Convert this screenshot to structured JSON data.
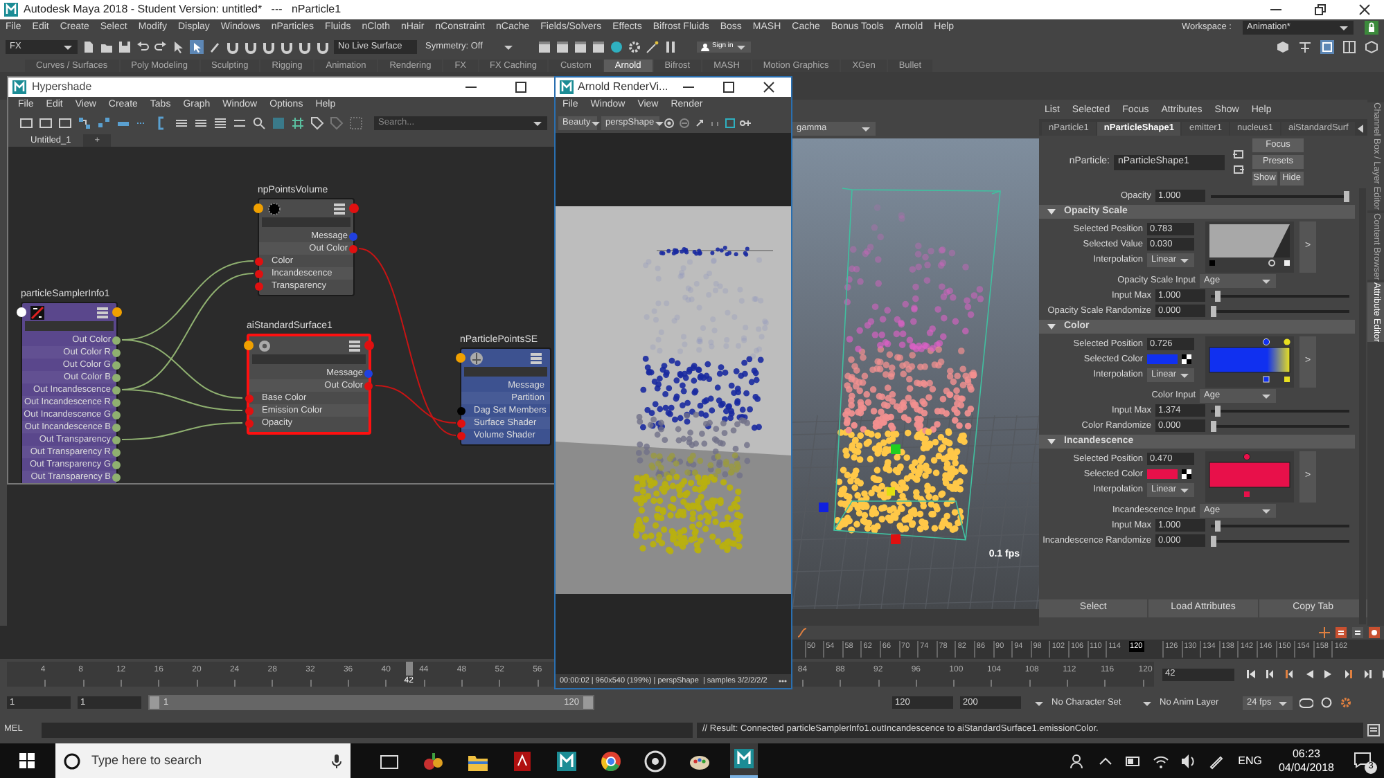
{
  "window": {
    "title": "Autodesk Maya 2018 - Student Version: untitled*   ---   nParticle1"
  },
  "menu_bar": [
    "File",
    "Edit",
    "Create",
    "Select",
    "Modify",
    "Display",
    "Windows",
    "nParticles",
    "Fluids",
    "nCloth",
    "nHair",
    "nConstraint",
    "nCache",
    "Fields/Solvers",
    "Effects",
    "Bifrost Fluids",
    "Boss",
    "MASH",
    "Cache",
    "Bonus Tools",
    "Arnold",
    "Help"
  ],
  "workspace": {
    "label": "Workspace :",
    "value": "Animation*"
  },
  "status_line": {
    "menu_set": "FX",
    "live_surface": "No Live Surface",
    "symmetry": "Symmetry: Off",
    "sign_in": "Sign in"
  },
  "shelf_tabs": [
    {
      "label": "Curves / Surfaces",
      "selected": false
    },
    {
      "label": "Poly Modeling",
      "selected": false
    },
    {
      "label": "Sculpting",
      "selected": false
    },
    {
      "label": "Rigging",
      "selected": false
    },
    {
      "label": "Animation",
      "selected": false
    },
    {
      "label": "Rendering",
      "selected": false
    },
    {
      "label": "FX",
      "selected": false
    },
    {
      "label": "FX Caching",
      "selected": false
    },
    {
      "label": "Custom",
      "selected": false
    },
    {
      "label": "Arnold",
      "selected": true
    },
    {
      "label": "Bifrost",
      "selected": false
    },
    {
      "label": "MASH",
      "selected": false
    },
    {
      "label": "Motion Graphics",
      "selected": false
    },
    {
      "label": "XGen",
      "selected": false
    },
    {
      "label": "Bullet",
      "selected": false
    }
  ],
  "hypershade": {
    "title": "Hypershade",
    "menu": [
      "File",
      "Edit",
      "View",
      "Create",
      "Tabs",
      "Graph",
      "Window",
      "Options",
      "Help"
    ],
    "search": {
      "placeholder": "Search..."
    },
    "tabs": [
      {
        "label": "Untitled_1",
        "selected": true
      },
      {
        "label": "+",
        "selected": false
      }
    ],
    "nodes": [
      {
        "name": "npPointsVolume",
        "kind": "volume_shader",
        "selected": false,
        "ports": [
          {
            "label": "Message",
            "kind": "out",
            "color": "#2040e0"
          },
          {
            "label": "Out Color",
            "kind": "out",
            "color": "#e01010"
          },
          {
            "label": "Color",
            "kind": "in",
            "color": "#e01010"
          },
          {
            "label": "Incandescence",
            "kind": "in",
            "color": "#e01010"
          },
          {
            "label": "Transparency",
            "kind": "in",
            "color": "#e01010"
          }
        ]
      },
      {
        "name": "particleSamplerInfo1",
        "kind": "utility",
        "selected": false,
        "ports": [
          {
            "label": "Out Color",
            "kind": "out",
            "color": "#8fb070"
          },
          {
            "label": "Out Color R",
            "kind": "out",
            "color": "#8fb070"
          },
          {
            "label": "Out Color G",
            "kind": "out",
            "color": "#8fb070"
          },
          {
            "label": "Out Color B",
            "kind": "out",
            "color": "#8fb070"
          },
          {
            "label": "Out Incandescence",
            "kind": "out",
            "color": "#8fb070"
          },
          {
            "label": "Out Incandescence R",
            "kind": "out",
            "color": "#8fb070"
          },
          {
            "label": "Out Incandescence G",
            "kind": "out",
            "color": "#8fb070"
          },
          {
            "label": "Out Incandescence B",
            "kind": "out",
            "color": "#8fb070"
          },
          {
            "label": "Out Transparency",
            "kind": "out",
            "color": "#8fb070"
          },
          {
            "label": "Out Transparency R",
            "kind": "out",
            "color": "#8fb070"
          },
          {
            "label": "Out Transparency G",
            "kind": "out",
            "color": "#8fb070"
          },
          {
            "label": "Out Transparency B",
            "kind": "out",
            "color": "#8fb070"
          }
        ]
      },
      {
        "name": "aiStandardSurface1",
        "kind": "surface_shader",
        "selected": true,
        "ports": [
          {
            "label": "Message",
            "kind": "out",
            "color": "#2040e0"
          },
          {
            "label": "Out Color",
            "kind": "out",
            "color": "#e01010"
          },
          {
            "label": "Base Color",
            "kind": "in",
            "color": "#e01010"
          },
          {
            "label": "Emission Color",
            "kind": "in",
            "color": "#e01010"
          },
          {
            "label": "Opacity",
            "kind": "in",
            "color": "#e01010"
          }
        ]
      },
      {
        "name": "nParticlePointsSE",
        "kind": "shading_group",
        "selected": false,
        "ports": [
          {
            "label": "Message",
            "kind": "out"
          },
          {
            "label": "Partition",
            "kind": "out"
          },
          {
            "label": "Dag Set Members",
            "kind": "in",
            "color": "#000000"
          },
          {
            "label": "Surface Shader",
            "kind": "in",
            "color": "#e01010"
          },
          {
            "label": "Volume Shader",
            "kind": "in",
            "color": "#e01010"
          }
        ]
      }
    ]
  },
  "render_view": {
    "title": "Arnold RenderVi...",
    "menu": [
      "File",
      "Window",
      "View",
      "Render"
    ],
    "aov": "Beauty",
    "camera": "perspShape",
    "status": "00:00:02 | 960x540 (199%) | perspShape  | samples 3/2/2/2/2"
  },
  "viewport": {
    "color_management": "gamma",
    "fps": "0.1 fps"
  },
  "attribute_editor": {
    "menu": [
      "List",
      "Selected",
      "Focus",
      "Attributes",
      "Show",
      "Help"
    ],
    "tabs": [
      {
        "label": "nParticle1",
        "selected": false
      },
      {
        "label": "nParticleShape1",
        "selected": true
      },
      {
        "label": "emitter1",
        "selected": false
      },
      {
        "label": "nucleus1",
        "selected": false
      },
      {
        "label": "aiStandardSurf",
        "selected": false
      }
    ],
    "node": {
      "label": "nParticle:",
      "value": "nParticleShape1"
    },
    "buttons": [
      "Focus",
      "Presets",
      "Show",
      "Hide"
    ],
    "opacity": {
      "label": "Opacity",
      "value": "1.000",
      "level": 1
    },
    "sections": [
      {
        "title": "Opacity Scale",
        "expanded": true,
        "kind": "curve",
        "ramp_button": ">",
        "fields": [
          {
            "label": "Selected Position",
            "value": "0.783",
            "kind": "number"
          },
          {
            "label": "Selected Value",
            "value": "0.030",
            "kind": "number"
          },
          {
            "label": "Interpolation",
            "value": "Linear",
            "kind": "dropdown"
          }
        ],
        "rows": [
          {
            "label": "Opacity Scale Input",
            "value": "Age",
            "kind": "dropdown"
          },
          {
            "label": "Input Max",
            "value": "1.000",
            "kind": "slider",
            "level": 0.03
          },
          {
            "label": "Opacity Scale Randomize",
            "value": "0.000",
            "kind": "slider",
            "level": 0
          }
        ]
      },
      {
        "title": "Color",
        "expanded": true,
        "kind": "gradient",
        "ramp_button": ">",
        "fields": [
          {
            "label": "Selected Position",
            "value": "0.726",
            "kind": "number"
          },
          {
            "label": "Selected Color",
            "kind": "color",
            "color": "#1030f0"
          },
          {
            "label": "Interpolation",
            "value": "Linear",
            "kind": "dropdown"
          }
        ],
        "rows": [
          {
            "label": "Color Input",
            "value": "Age",
            "kind": "dropdown"
          },
          {
            "label": "Input Max",
            "value": "1.374",
            "kind": "slider",
            "level": 0.03
          },
          {
            "label": "Color Randomize",
            "value": "0.000",
            "kind": "slider",
            "level": 0
          }
        ]
      },
      {
        "title": "Incandescence",
        "expanded": true,
        "kind": "solid",
        "ramp_button": ">",
        "fields": [
          {
            "label": "Selected Position",
            "value": "0.470",
            "kind": "number"
          },
          {
            "label": "Selected Color",
            "kind": "color",
            "color": "#e8104a"
          },
          {
            "label": "Interpolation",
            "value": "Linear",
            "kind": "dropdown"
          }
        ],
        "rows": [
          {
            "label": "Incandescence Input",
            "value": "Age",
            "kind": "dropdown"
          },
          {
            "label": "Input Max",
            "value": "1.000",
            "kind": "slider",
            "level": 0.03
          },
          {
            "label": "Incandescence Randomize",
            "value": "0.000",
            "kind": "slider",
            "level": 0
          }
        ]
      }
    ],
    "bottom_buttons": [
      "Select",
      "Load Attributes",
      "Copy Tab"
    ]
  },
  "side_tabs": [
    {
      "label": "Channel Box / Layer Editor",
      "selected": false
    },
    {
      "label": "Content Browser",
      "selected": false
    },
    {
      "label": "Attribute Editor",
      "selected": true
    }
  ],
  "time_strip": {
    "ticks": [
      "50",
      "54",
      "58",
      "62",
      "66",
      "70",
      "74",
      "78",
      "82",
      "86",
      "90",
      "94",
      "98",
      "102",
      "106",
      "110",
      "114",
      "126",
      "130",
      "134",
      "138",
      "142",
      "146",
      "150",
      "154",
      "158",
      "162"
    ],
    "current": "120"
  },
  "time_slider": {
    "ticks": [
      "4",
      "8",
      "12",
      "16",
      "20",
      "24",
      "28",
      "32",
      "36",
      "40",
      "44",
      "48",
      "52",
      "56",
      "84",
      "88",
      "92",
      "96",
      "100",
      "104",
      "108",
      "112",
      "116",
      "120"
    ],
    "current": "42",
    "level": 0.35,
    "current_frame": "42"
  },
  "range_slider": {
    "start": "1",
    "playback_start": "1",
    "range_start": "1",
    "range_end": "120",
    "level": 1,
    "playback_end": "120",
    "end": "200",
    "character_set": "No Character Set",
    "anim_layer": "No Anim Layer",
    "fps": "24 fps"
  },
  "command_line": {
    "language": "MEL",
    "result": "// Result: Connected particleSamplerInfo1.outIncandescence to aiStandardSurface1.emissionColor."
  },
  "taskbar": {
    "search": {
      "placeholder": "Type here to search"
    },
    "language": "ENG",
    "time": "06:23",
    "date": "04/04/2018",
    "notifications": "3"
  }
}
